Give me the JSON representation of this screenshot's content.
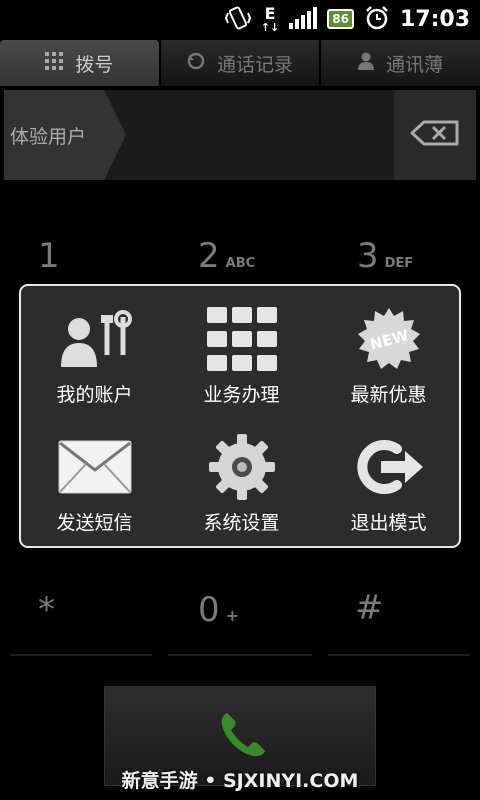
{
  "status_bar": {
    "network_type": "E",
    "battery_level": "86",
    "time": "17:03",
    "icons": [
      "vibrate-icon",
      "data-arrows-icon",
      "signal-icon",
      "battery-icon",
      "alarm-icon"
    ]
  },
  "tabs": [
    {
      "label": "拨号",
      "icon": "keypad-icon",
      "active": true
    },
    {
      "label": "通话记录",
      "icon": "call-log-icon",
      "active": false
    },
    {
      "label": "通讯薄",
      "icon": "contact-icon",
      "active": false
    }
  ],
  "input": {
    "label": "体验用户",
    "backspace_icon": "backspace-icon"
  },
  "keypad": {
    "keys": [
      {
        "digit": "1",
        "letters": ""
      },
      {
        "digit": "2",
        "letters": "ABC"
      },
      {
        "digit": "3",
        "letters": "DEF"
      },
      {
        "digit": "*",
        "letters": ""
      },
      {
        "digit": "0",
        "letters": "+"
      },
      {
        "digit": "#",
        "letters": ""
      }
    ]
  },
  "menu": {
    "items": [
      {
        "label": "我的账户",
        "icon": "account-settings-icon"
      },
      {
        "label": "业务办理",
        "icon": "grid-icon"
      },
      {
        "label": "最新优惠",
        "icon": "new-badge-icon",
        "badge": "NEW"
      },
      {
        "label": "发送短信",
        "icon": "envelope-icon"
      },
      {
        "label": "系统设置",
        "icon": "gear-icon"
      },
      {
        "label": "退出模式",
        "icon": "exit-icon"
      }
    ]
  },
  "call_button": {
    "icon": "phone-icon"
  },
  "watermark": "新意手游 • SJXINYI.COM",
  "colors": {
    "accent_green": "#3a8a2a",
    "menu_border": "#e8e8e8",
    "battery_green": "#5c8d2f"
  }
}
